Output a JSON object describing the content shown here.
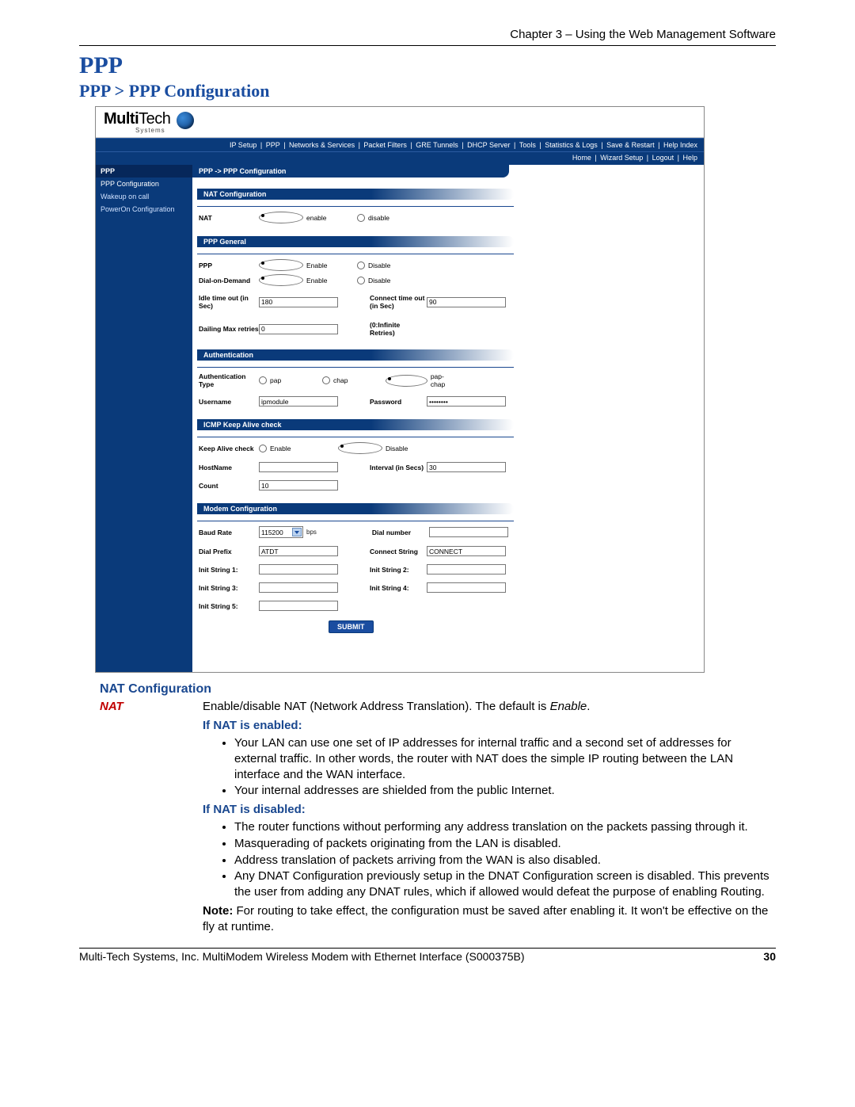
{
  "doc": {
    "chapter_header": "Chapter 3 – Using the Web Management Software",
    "h1": "PPP",
    "h2": "PPP > PPP Configuration",
    "footer_left": "Multi-Tech Systems, Inc. MultiModem Wireless Modem with Ethernet Interface (S000375B)",
    "footer_right": "30"
  },
  "shot": {
    "logo_multi": "Multi",
    "logo_tech": "Tech",
    "logo_systems": "Systems",
    "menu": [
      "IP Setup",
      "PPP",
      "Networks & Services",
      "Packet Filters",
      "GRE Tunnels",
      "DHCP Server",
      "Tools",
      "Statistics & Logs",
      "Save & Restart",
      "Help Index"
    ],
    "submenu": [
      "Home",
      "Wizard Setup",
      "Logout",
      "Help"
    ],
    "sidebar": {
      "cat": "PPP",
      "items": [
        "PPP Configuration",
        "Wakeup on call",
        "PowerOn Configuration"
      ]
    },
    "crumb": "PPP  ->  PPP Configuration",
    "sec_nat": {
      "title": "NAT Configuration",
      "lab_nat": "NAT",
      "enable": "enable",
      "disable": "disable"
    },
    "sec_ppp": {
      "title": "PPP General",
      "lab_ppp": "PPP",
      "lab_dod": "Dial-on-Demand",
      "enable": "Enable",
      "disable": "Disable",
      "lab_idle": "Idle time out  (in Sec)",
      "val_idle": "180",
      "lab_connect": "Connect time out  (in Sec)",
      "val_connect": "90",
      "lab_dialmax": "Dailing Max retries",
      "val_dialmax": "0",
      "note_dialmax": "(0:Infinite Retries)"
    },
    "sec_auth": {
      "title": "Authentication",
      "lab_type": "Authentication Type",
      "r_pap": "pap",
      "r_chap": "chap",
      "r_papchap": "pap-chap",
      "lab_user": "Username",
      "val_user": "ipmodule",
      "lab_pass": "Password",
      "val_pass": "••••••••"
    },
    "sec_icmp": {
      "title": "ICMP Keep Alive check",
      "lab_keep": "Keep Alive check",
      "enable": "Enable",
      "disable": "Disable",
      "lab_host": "HostName",
      "val_host": "",
      "lab_interval": "Interval (in Secs)",
      "val_interval": "30",
      "lab_count": "Count",
      "val_count": "10"
    },
    "sec_modem": {
      "title": "Modem Configuration",
      "lab_baud": "Baud Rate",
      "val_baud": "115200",
      "unit_bps": "bps",
      "lab_dialnum": "Dial number",
      "val_dialnum": "",
      "lab_dialprefix": "Dial Prefix",
      "val_dialprefix": "ATDT",
      "lab_connstr": "Connect String",
      "val_connstr": "CONNECT",
      "lab_init1": "Init String 1:",
      "lab_init2": "Init String 2:",
      "lab_init3": "Init String 3:",
      "lab_init4": "Init String 4:",
      "lab_init5": "Init String 5:",
      "submit": "SUBMIT"
    }
  },
  "body": {
    "h3": "NAT Configuration",
    "key": "NAT",
    "intro1": "Enable/disable NAT (Network Address Translation). The default is ",
    "intro_em": "Enable",
    "intro_end": ".",
    "sub_enabled": "If NAT is enabled:",
    "enabled_bullets": [
      "Your LAN can use one set of IP addresses for internal traffic and a second set of addresses for external traffic. In other words, the router with NAT does the simple IP routing between the LAN interface and the WAN interface.",
      "Your internal addresses are shielded from the public Internet."
    ],
    "sub_disabled": "If NAT is disabled:",
    "disabled_bullets": [
      "The router functions without performing any address translation on the packets passing through it.",
      "Masquerading of packets originating from the LAN is disabled.",
      "Address translation of packets arriving from the WAN is also disabled.",
      "Any DNAT Configuration previously setup in the DNAT Configuration screen is disabled. This prevents the user from adding any DNAT rules, which if allowed would defeat the purpose of enabling Routing."
    ],
    "note_b": "Note:",
    "note": " For routing to take effect, the configuration must be saved after enabling it. It won't be effective on the fly at runtime."
  }
}
